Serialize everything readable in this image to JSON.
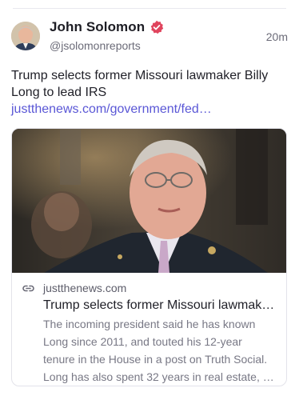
{
  "post": {
    "author_name": "John Solomon",
    "author_handle": "@jsolomonreports",
    "time": "20m",
    "text": "Trump selects former Missouri lawmaker Billy Long to lead IRS",
    "link_text": "justthenews.com/government/fed…",
    "accent_color": "#5a57d6",
    "verified_color": "#e0445d"
  },
  "card": {
    "domain": "justthenews.com",
    "title": "Trump selects former Missouri lawmaker Billy Long to lead IRS",
    "description_lines": [
      "The incoming president said he has known",
      "Long since 2011, and touted his 12-year",
      "tenure in the House in a post on Truth Social.",
      "Long has also spent 32 years in real estate, …"
    ]
  },
  "icons": {
    "verified": "verified-badge-icon",
    "link": "link-icon"
  }
}
